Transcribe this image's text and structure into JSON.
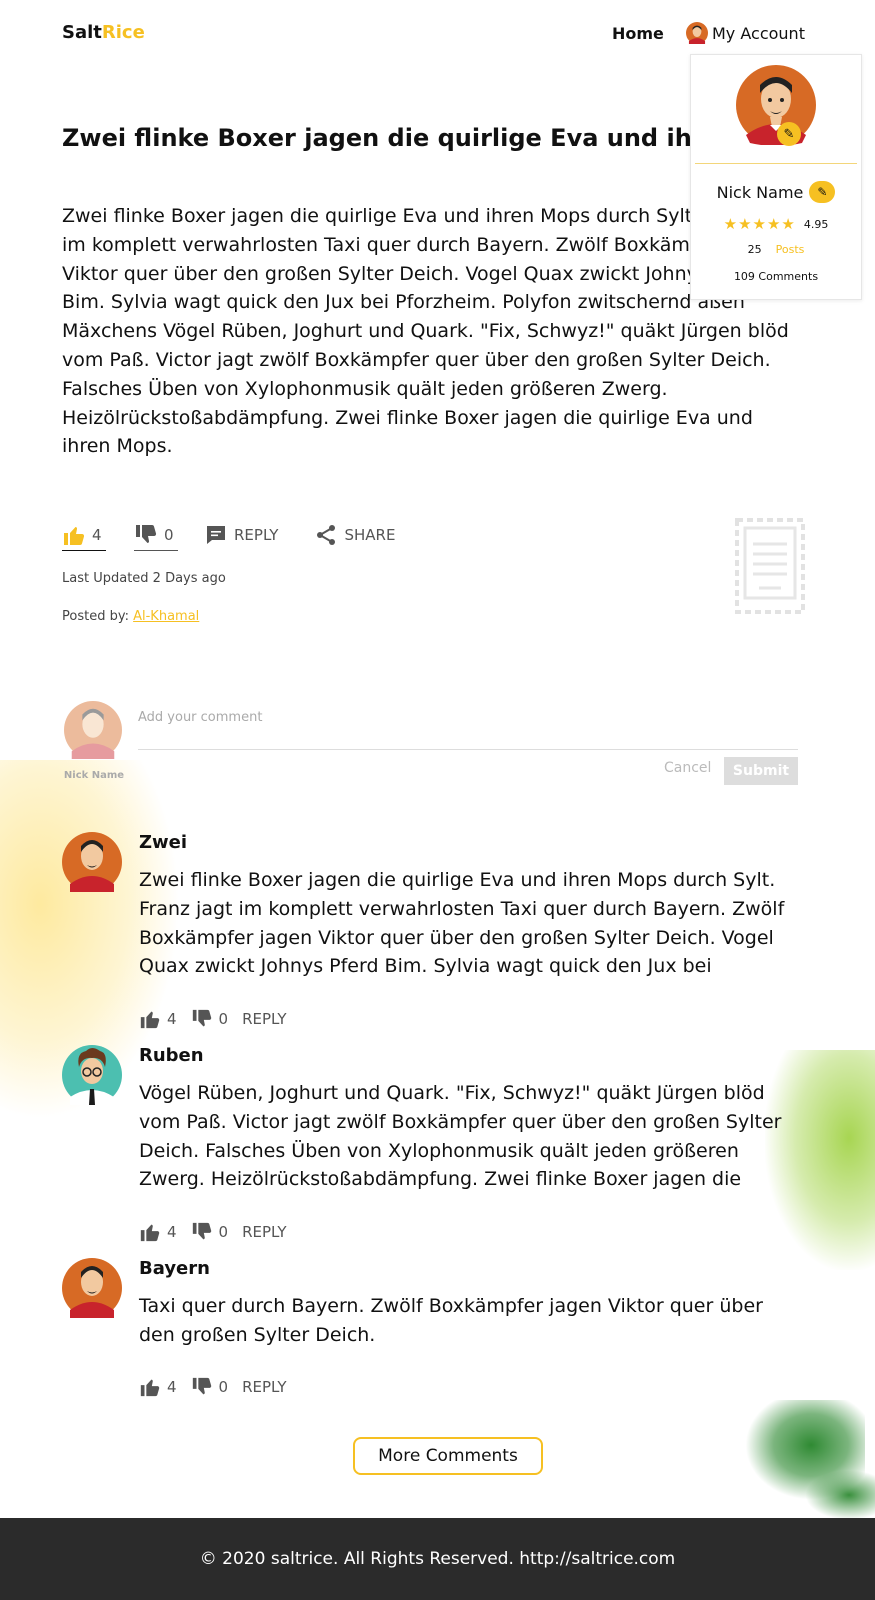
{
  "header": {
    "logo_part1": "Salt",
    "logo_part2": "Rice",
    "nav_home": "Home",
    "nav_account": "My Account"
  },
  "account_card": {
    "name": "Nick Name",
    "rating": "4.95",
    "stars": 5,
    "posts_count": "25",
    "posts_label": "Posts",
    "comments": "109 Comments"
  },
  "article": {
    "title": "Zwei flinke Boxer jagen die quirlige Eva und ihren Mops durch Sylt.",
    "body": "Zwei flinke Boxer jagen die quirlige Eva und ihren Mops durch Sylt. Franz jagt im komplett verwahrlosten Taxi quer durch Bayern. Zwölf Boxkämpfer jagen Viktor quer über den großen Sylter Deich. Vogel Quax zwickt Johnys Pferd Bim. Sylvia wagt quick den Jux bei Pforzheim. Polyfon zwitschernd aßen Mäxchens Vögel Rüben, Joghurt und Quark. \"Fix, Schwyz!\" quäkt Jürgen blöd vom Paß. Victor jagt zwölf Boxkämpfer quer über den großen Sylter Deich. Falsches Üben von Xylophonmusik quält jeden größeren Zwerg. Heizölrückstoßabdämpfung. Zwei flinke Boxer jagen die quirlige Eva und ihren Mops.",
    "likes": "4",
    "dislikes": "0",
    "reply_label": "REPLY",
    "share_label": "SHARE",
    "last_updated": "Last Updated 2 Days ago",
    "posted_by_label": "Posted by:",
    "posted_by_name": "Al-Khamal"
  },
  "composer": {
    "user_name": "Nick Name",
    "placeholder": "Add your comment",
    "cancel_label": "Cancel",
    "submit_label": "Submit"
  },
  "comments": [
    {
      "author": "Zwei",
      "body": "Zwei flinke Boxer jagen die quirlige Eva und ihren Mops durch Sylt. Franz jagt im komplett verwahrlosten Taxi quer durch Bayern. Zwölf Boxkämpfer jagen Viktor quer über den großen Sylter Deich. Vogel Quax zwickt Johnys Pferd Bim. Sylvia wagt quick den Jux bei",
      "likes": "4",
      "dislikes": "0",
      "reply_label": "REPLY"
    },
    {
      "author": "Ruben",
      "body": "Vögel Rüben, Joghurt und Quark. \"Fix, Schwyz!\" quäkt Jürgen blöd vom Paß. Victor jagt zwölf Boxkämpfer quer über den großen Sylter Deich. Falsches Üben von Xylophonmusik quält jeden größeren Zwerg. Heizölrückstoßabdämpfung. Zwei flinke Boxer jagen die",
      "likes": "4",
      "dislikes": "0",
      "reply_label": "REPLY"
    },
    {
      "author": "Bayern",
      "body": "Taxi quer durch Bayern. Zwölf Boxkämpfer jagen Viktor quer über den großen Sylter Deich.",
      "likes": "4",
      "dislikes": "0",
      "reply_label": "REPLY"
    }
  ],
  "more_comments_label": "More Comments",
  "footer": {
    "text": "© 2020 saltrice. All Rights Reserved. http://saltrice.com"
  },
  "colors": {
    "accent": "#f6c022",
    "footer_bg": "#2b2b2b"
  }
}
